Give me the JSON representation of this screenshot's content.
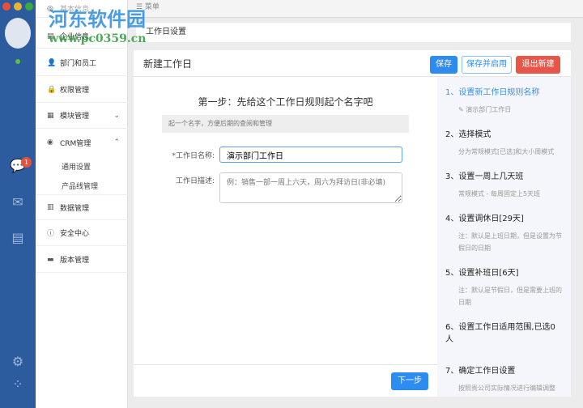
{
  "window": {
    "colors": {
      "close": "#e8503c",
      "min": "#e7b52f",
      "max": "#3aaa3a"
    }
  },
  "rail": {
    "badge": "1"
  },
  "topbar": {
    "label": "☰ 菜单"
  },
  "menu": {
    "items": [
      {
        "icon": "◎",
        "label": "基本信息"
      },
      {
        "icon": "▤",
        "label": "企业信息"
      },
      {
        "icon": "👤",
        "label": "部门和员工"
      },
      {
        "icon": "🔒",
        "label": "权限管理"
      },
      {
        "icon": "▦",
        "label": "模块管理"
      },
      {
        "icon": "◉",
        "label": "CRM管理"
      },
      {
        "icon": "▥",
        "label": "数据管理"
      },
      {
        "icon": "ⓘ",
        "label": "安全中心"
      },
      {
        "icon": "▬",
        "label": "版本管理"
      }
    ],
    "crm_sub": [
      "通用设置",
      "产品线管理"
    ]
  },
  "breadcrumb": "工作日设置",
  "panel": {
    "title": "新建工作日",
    "save": "保存",
    "save_enable": "保存并启用",
    "exit": "退出新建",
    "step_heading": "第一步：先给这个工作日规则起个名字吧",
    "hint": "起一个名字，方便后期的查阅和管理",
    "name_label": "*工作日名称:",
    "name_value": "演示部门工作日",
    "desc_label": "工作日描述:",
    "desc_placeholder": "例：销售一部一周上六天，周六为拜访日(非必填)",
    "next": "下一步"
  },
  "steps": [
    {
      "title": "1、设置新工作日规则名称",
      "desc": "✎ 演示部门工作日"
    },
    {
      "title": "2、选择模式",
      "desc": "分为常规模式[已选]和大小周模式"
    },
    {
      "title": "3、设置一周上几天班",
      "desc": "常规模式 - 每周固定上5天班"
    },
    {
      "title": "4、设置调休日[29天]",
      "desc": "注：默认是上班日期，但是设置为节假日的日期"
    },
    {
      "title": "5、设置补班日[6天]",
      "desc": "注：默认是节假日，但是需要上班的日期"
    },
    {
      "title": "6、设置工作日适用范围,已选0人",
      "desc": ""
    },
    {
      "title": "7、确定工作日设置",
      "desc": "按照贵公司实际情况进行编辑调整"
    }
  ],
  "watermark": {
    "line1": "河东软件园",
    "line2": "www.pc0359.cn"
  }
}
